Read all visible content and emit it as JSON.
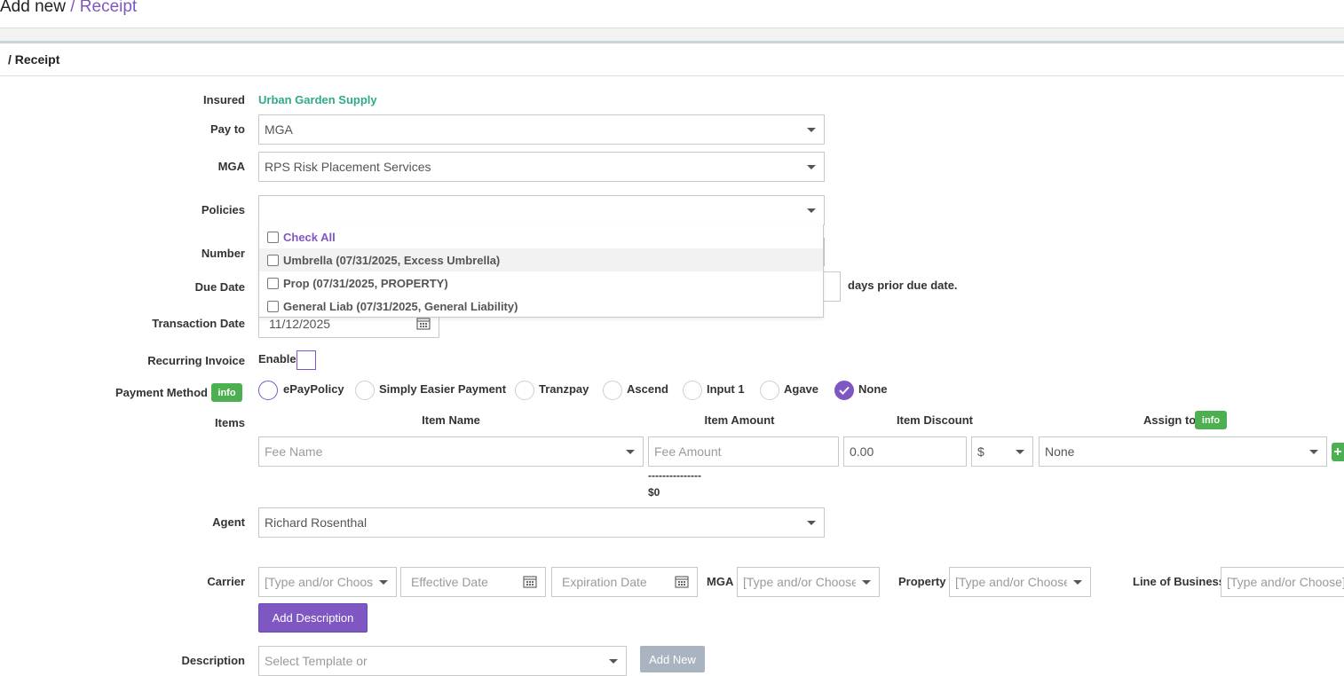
{
  "header": {
    "title_prefix": "Add new",
    "title_crumb": "/ Receipt"
  },
  "section": {
    "title": "/ Receipt"
  },
  "form": {
    "insured": {
      "label": "Insured",
      "value": "Urban Garden Supply",
      "color": "#2eaa8a"
    },
    "pay_to": {
      "label": "Pay to",
      "value": "MGA"
    },
    "mga": {
      "label": "MGA",
      "value": "RPS Risk Placement Services"
    },
    "policies": {
      "label": "Policies",
      "value": "",
      "options": [
        {
          "label": "Check All"
        },
        {
          "label": "Umbrella (07/31/2025, Excess Umbrella)"
        },
        {
          "label": "Prop (07/31/2025, PROPERTY)"
        },
        {
          "label": "General Liab (07/31/2025, General Liability)"
        }
      ]
    },
    "number": {
      "label": "Number"
    },
    "due_date": {
      "label": "Due Date",
      "suffix": "days prior due date."
    },
    "transaction_date": {
      "label": "Transaction Date",
      "value": "11/12/2025"
    },
    "recurring_invoice": {
      "label": "Recurring Invoice",
      "enable_label": "Enable",
      "checked": false
    },
    "payment_method": {
      "label": "Payment Method",
      "info_badge": "info",
      "options": [
        {
          "label": "ePayPolicy"
        },
        {
          "label": "Simply Easier Payment"
        },
        {
          "label": "Tranzpay"
        },
        {
          "label": "Ascend"
        },
        {
          "label": "Input 1"
        },
        {
          "label": "Agave"
        },
        {
          "label": "None"
        }
      ],
      "selected": "None"
    },
    "items": {
      "label": "Items",
      "headers": {
        "name": "Item Name",
        "amount": "Item Amount",
        "discount": "Item Discount",
        "assign": "Assign to"
      },
      "assign_info_badge": "info",
      "row": {
        "name_placeholder": "Fee Name",
        "amount_placeholder": "Fee Amount",
        "discount_value": "0.00",
        "discount_type": "$",
        "assign_value": "None"
      },
      "total_divider": "---------------",
      "total": "$0"
    },
    "agent": {
      "label": "Agent",
      "value": "Richard Rosenthal"
    },
    "carrier": {
      "label": "Carrier",
      "placeholder": "[Type and/or Choose]",
      "effective_placeholder": "Effective Date",
      "expiration_placeholder": "Expiration Date",
      "mga_label": "MGA",
      "mga_placeholder": "[Type and/or Choose]",
      "property_label": "Property",
      "property_placeholder": "[Type and/or Choose]",
      "lob_label": "Line of Business",
      "lob_placeholder": "[Type and/or Choose]"
    },
    "add_description_button": "Add Description",
    "description": {
      "label": "Description",
      "placeholder": "Select Template or",
      "add_new_button": "Add New"
    }
  },
  "colors": {
    "accent": "#7e57c2",
    "info_green": "#4caf50",
    "insured_teal": "#2eaa8a"
  }
}
